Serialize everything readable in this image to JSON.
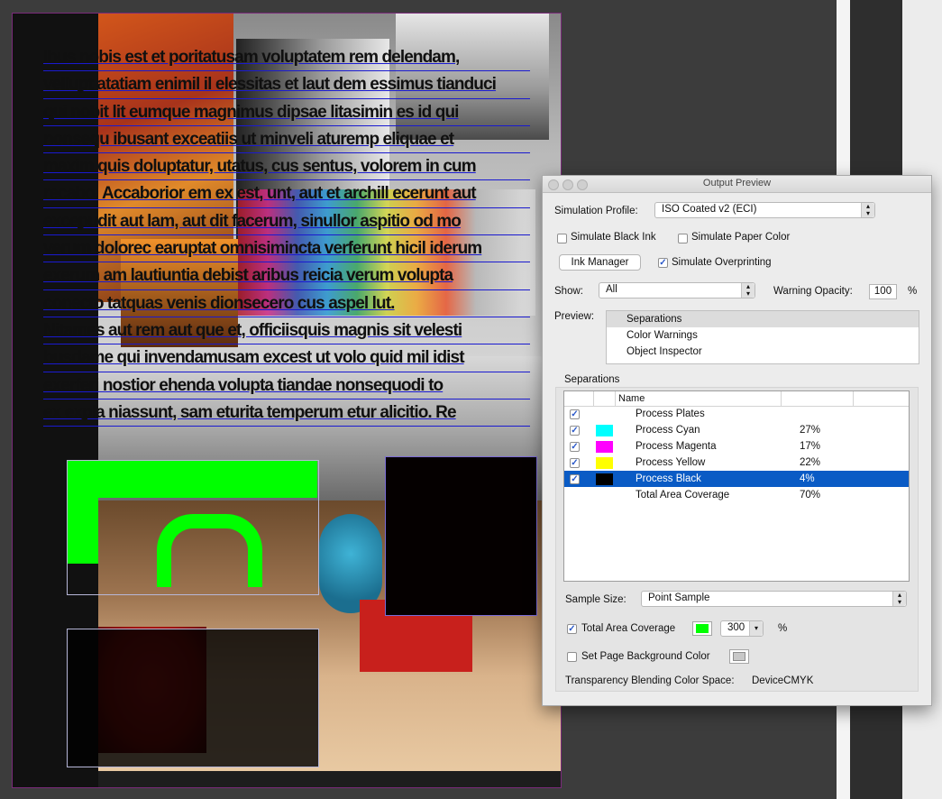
{
  "document": {
    "text_lines": [
      "Ibus nobis est et poritatusam voluptatem rem delendam,",
      "vellupt atatiam enimil il elessitas et laut dem essimus tianduci",
      "qui nobit lit eumque magnimus dipsae litasimin es id qui",
      "nonsequ ibusant exceatiis ut minveli aturemp eliquae et",
      "maxim quis doluptatur, utatus, cus sentus, volorem in cum",
      "recabo. Accaborior em ex est, unt, aut et archill ecerunt aut",
      "excepudit aut lam, aut dit facerum, sinullor aspitio od mo",
      "verum dolorec earuptat omnisimincta verferunt hicil iderum",
      "exerum am lautiuntia debist aribus reicia verum volupta",
      "conecto tatquas venis dionsecero cus aspel lut.",
      "Nitames aut rem aut que et, officiisquis magnis sit velesti",
      "busdame qui invendamusam excest ut volo quid mil idist",
      "exerferi nostior ehenda volupta tiandae nonsequodi to",
      "ex expla niassunt, sam eturita temperum etur alicitio. Re"
    ],
    "overlay_green": "#00ff00",
    "frame_border": "#7a2a7a",
    "text_underline": "#1a1ad0"
  },
  "panel": {
    "title": "Output Preview",
    "simulation_profile_label": "Simulation Profile:",
    "simulation_profile_value": "ISO Coated v2 (ECI)",
    "simulate_black_ink": "Simulate Black Ink",
    "simulate_black_ink_checked": false,
    "simulate_paper_color": "Simulate Paper Color",
    "simulate_paper_color_checked": false,
    "ink_manager": "Ink Manager",
    "simulate_overprinting": "Simulate Overprinting",
    "simulate_overprinting_checked": true,
    "show_label": "Show:",
    "show_value": "All",
    "warning_opacity_label": "Warning Opacity:",
    "warning_opacity_value": "100",
    "percent": "%",
    "preview_label": "Preview:",
    "preview_items": [
      "Separations",
      "Color Warnings",
      "Object Inspector"
    ],
    "preview_selected": "Separations",
    "separations_group_label": "Separations",
    "col_name": "Name",
    "separations": [
      {
        "name": "Process Plates",
        "percent": "",
        "checked": true,
        "color": ""
      },
      {
        "name": "Process Cyan",
        "percent": "27%",
        "checked": true,
        "color": "#00ffff"
      },
      {
        "name": "Process Magenta",
        "percent": "17%",
        "checked": true,
        "color": "#ff00ff"
      },
      {
        "name": "Process Yellow",
        "percent": "22%",
        "checked": true,
        "color": "#ffff00"
      },
      {
        "name": "Process Black",
        "percent": "4%",
        "checked": true,
        "color": "#000000"
      },
      {
        "name": "Total Area Coverage",
        "percent": "70%",
        "checked": false,
        "color": ""
      }
    ],
    "selected_separation": "Process Black",
    "sample_size_label": "Sample Size:",
    "sample_size_value": "Point Sample",
    "total_area_coverage": "Total Area Coverage",
    "total_area_coverage_checked": true,
    "tac_color": "#00ff00",
    "tac_value": "300",
    "set_page_bg": "Set Page Background Color",
    "set_page_bg_checked": false,
    "page_bg_color": "#c8c8c8",
    "blending_label": "Transparency Blending Color Space:",
    "blending_value": "DeviceCMYK",
    "selection_color": "#0a5bc5"
  }
}
